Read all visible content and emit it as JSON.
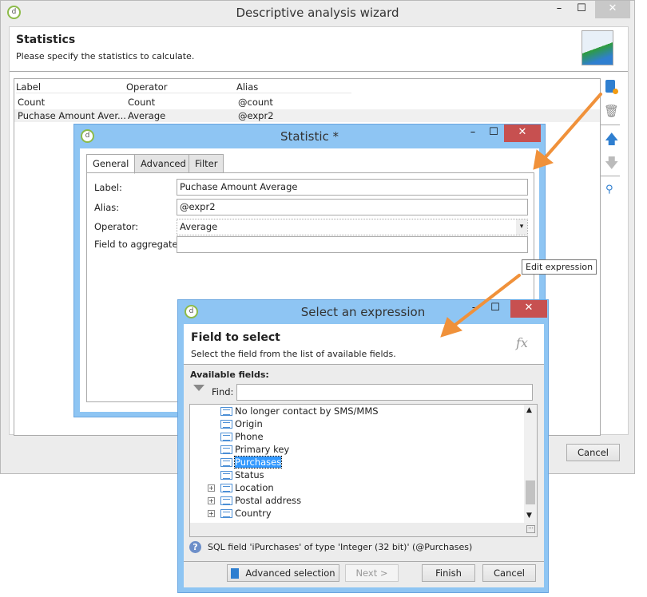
{
  "main": {
    "title": "Descriptive analysis wizard",
    "heading": "Statistics",
    "subtitle": "Please specify the statistics to calculate.",
    "columns": [
      "Label",
      "Operator",
      "Alias"
    ],
    "rows": [
      {
        "label": "Count",
        "operator": "Count",
        "alias": "@count"
      },
      {
        "label": "Puchase Amount Aver...",
        "operator": "Average",
        "alias": "@expr2"
      }
    ],
    "cancel": "Cancel"
  },
  "statistic": {
    "title": "Statistic *",
    "tabs": [
      "General",
      "Advanced",
      "Filter"
    ],
    "label_label": "Label:",
    "label_value": "Puchase Amount Average",
    "alias_label": "Alias:",
    "alias_value": "@expr2",
    "operator_label": "Operator:",
    "operator_value": "Average",
    "field_label": "Field to aggregate:",
    "field_value": "",
    "tooltip": "Edit expression"
  },
  "expr": {
    "title": "Select an expression",
    "heading": "Field to select",
    "subtitle": "Select the field from the list of available fields.",
    "fx": "fx",
    "available": "Available fields:",
    "find_label": "Find:",
    "find_value": "",
    "items": [
      "No longer contact by SMS/MMS",
      "Origin",
      "Phone",
      "Primary key",
      "Purchases",
      "Status"
    ],
    "groups": [
      "Location",
      "Postal address",
      "Country"
    ],
    "status": "SQL field 'iPurchases' of type 'Integer (32 bit)' (@Purchases)",
    "buttons": {
      "advanced": "Advanced selection",
      "next": "Next >",
      "finish": "Finish",
      "cancel": "Cancel"
    }
  },
  "colors": {
    "accent": "#3399ff",
    "titlebar_active": "#8ec5f3",
    "close": "#c75050",
    "arrow": "#f0913a"
  }
}
